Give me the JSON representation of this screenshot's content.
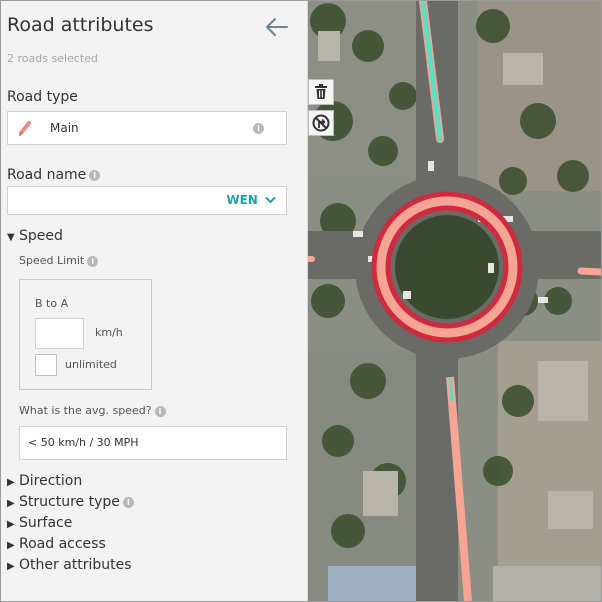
{
  "panel": {
    "title": "Road attributes",
    "subtitle": "2 roads selected",
    "icons": {
      "back": "arrow-left-icon",
      "road_type": "pencil-icon",
      "info": "info-icon",
      "dropdown": "chevron-down-icon"
    },
    "road_type": {
      "label": "Road type",
      "value": "Main",
      "color": "#f08c8c"
    },
    "road_name": {
      "label": "Road name",
      "value": "",
      "language": "WEN"
    },
    "speed": {
      "section_label": "Speed",
      "speed_limit_label": "Speed Limit",
      "direction_label": "B to A",
      "value": "",
      "unit": "km/h",
      "unlimited_label": "unlimited",
      "unlimited_checked": false,
      "avg_speed_label": "What is the avg. speed?",
      "avg_speed_value": "< 50 km/h / 30 MPH"
    },
    "sections": [
      "Direction",
      "Structure type",
      "Surface",
      "Road access",
      "Other attributes"
    ]
  },
  "map": {
    "tools": [
      "delete-icon",
      "turn-restriction-icon"
    ],
    "colors": {
      "selection_outline": "#cf2a3e",
      "selected_road": "#f6a493",
      "road_highlight": "#5fdcc2"
    }
  }
}
